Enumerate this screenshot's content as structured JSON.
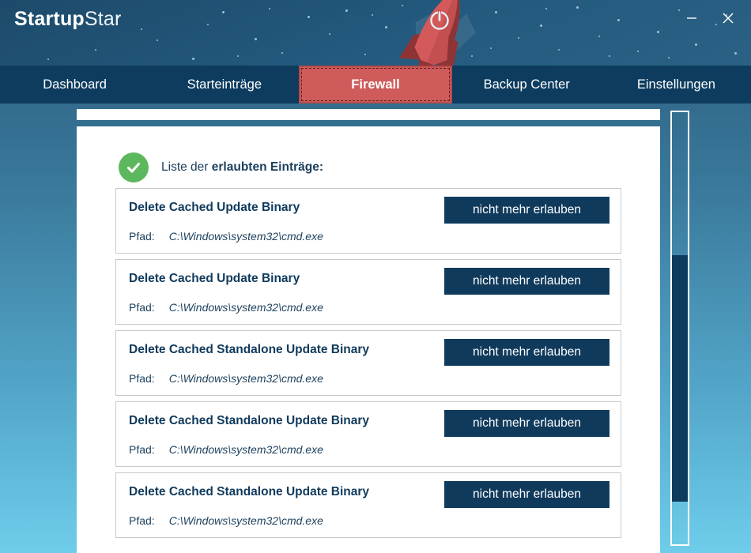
{
  "window": {
    "app_name_bold": "Startup",
    "app_name_light": "Star",
    "minimize_label": "–",
    "close_label": "✕"
  },
  "nav": {
    "items": [
      {
        "label": "Dashboard",
        "active": false
      },
      {
        "label": "Starteinträge",
        "active": false
      },
      {
        "label": "Firewall",
        "active": true
      },
      {
        "label": "Backup Center",
        "active": false
      },
      {
        "label": "Einstellungen",
        "active": false
      }
    ]
  },
  "list_header": {
    "text_regular": "Liste der ",
    "text_bold": "erlaubten Einträge:"
  },
  "rows": [
    {
      "title": "Delete Cached Update Binary",
      "path_label": "Pfad:",
      "path_value": "C:\\Windows\\system32\\cmd.exe",
      "button_label": "nicht mehr erlauben"
    },
    {
      "title": "Delete Cached Update Binary",
      "path_label": "Pfad:",
      "path_value": "C:\\Windows\\system32\\cmd.exe",
      "button_label": "nicht mehr erlauben"
    },
    {
      "title": "Delete Cached Standalone Update Binary",
      "path_label": "Pfad:",
      "path_value": "C:\\Windows\\system32\\cmd.exe",
      "button_label": "nicht mehr erlauben"
    },
    {
      "title": "Delete Cached Standalone Update Binary",
      "path_label": "Pfad:",
      "path_value": "C:\\Windows\\system32\\cmd.exe",
      "button_label": "nicht mehr erlauben"
    },
    {
      "title": "Delete Cached Standalone Update Binary",
      "path_label": "Pfad:",
      "path_value": "C:\\Windows\\system32\\cmd.exe",
      "button_label": "nicht mehr erlauben"
    }
  ],
  "icons": {
    "check": "check-icon",
    "rocket": "rocket-icon",
    "power": "power-icon",
    "minimize": "minimize-icon",
    "close": "close-icon"
  },
  "colors": {
    "accent_red": "#cf5b5b",
    "navy": "#0d3c5f",
    "button_navy": "#103a5c",
    "success_green": "#5cb85c",
    "bg_top": "#2a5b7c",
    "bg_bottom": "#6ecdea"
  }
}
